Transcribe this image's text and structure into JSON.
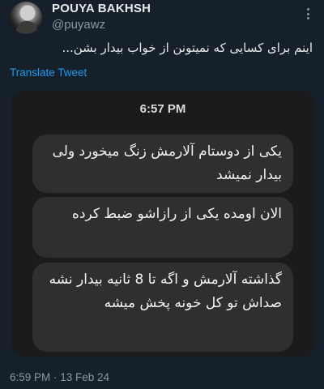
{
  "author": {
    "name": "POUYA BAKHSH",
    "handle": "@puyawz"
  },
  "tweet": {
    "text": "اینم برای کسایی که نمیتونن از خواب بیدار بشن...",
    "translate_label": "Translate Tweet",
    "timestamp": "6:59 PM · 13 Feb 24"
  },
  "screenshot": {
    "time": "6:57 PM",
    "messages": [
      "یکی از دوستام آلارمش زنگ میخورد ولی بیدار نمیشد",
      "الان اومده یکی از رازاشو ضبط کرده",
      "گذاشته آلارمش و اگه تا 8 ثانیه بیدار نشه صداش تو کل خونه پخش میشه"
    ]
  },
  "icons": {
    "more": "more-options-icon"
  }
}
